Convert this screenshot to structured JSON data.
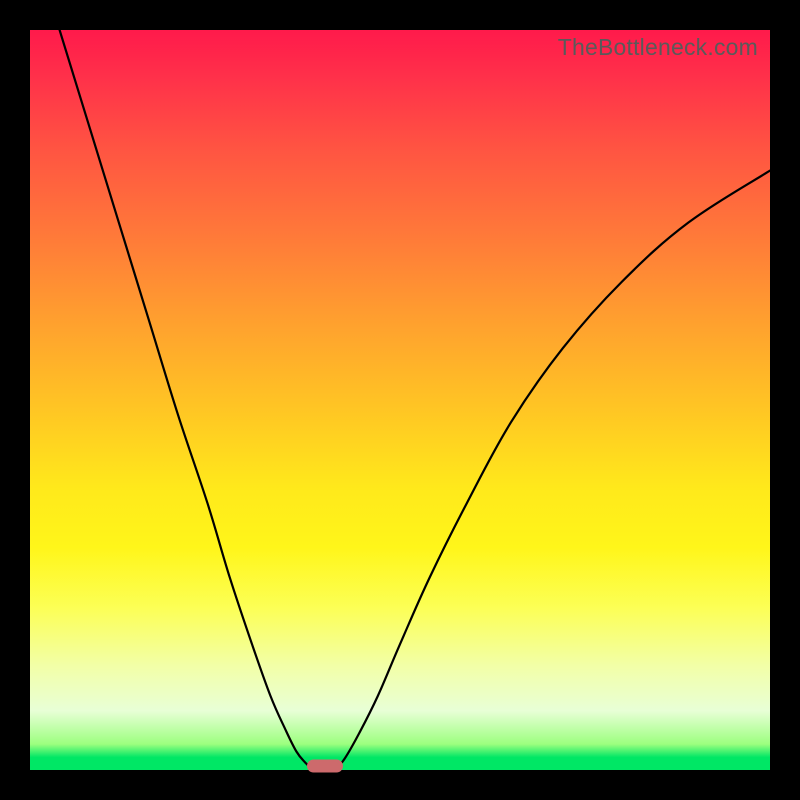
{
  "watermark": "TheBottleneck.com",
  "chart_data": {
    "type": "line",
    "title": "",
    "xlabel": "",
    "ylabel": "",
    "xlim": [
      0,
      100
    ],
    "ylim": [
      0,
      100
    ],
    "grid": false,
    "legend": false,
    "series": [
      {
        "name": "left-curve",
        "x": [
          4,
          8,
          12,
          16,
          20,
          24,
          27,
          30,
          32.5,
          34.5,
          36,
          37.2,
          38,
          38.4
        ],
        "y": [
          100,
          87,
          74,
          61,
          48,
          36,
          26,
          17,
          10,
          5.5,
          2.5,
          1,
          0.3,
          0
        ]
      },
      {
        "name": "right-curve",
        "x": [
          41.2,
          42.5,
          44.5,
          47,
          50,
          54,
          59,
          65,
          72,
          80,
          89,
          100
        ],
        "y": [
          0,
          1.5,
          5,
          10,
          17,
          26,
          36,
          47,
          57,
          66,
          74,
          81
        ]
      }
    ],
    "marker": {
      "x": 39.8,
      "y": 0.6
    },
    "background_gradient": {
      "top": "#ff1a4b",
      "mid": "#ffe91b",
      "bottom": "#00e765"
    }
  }
}
